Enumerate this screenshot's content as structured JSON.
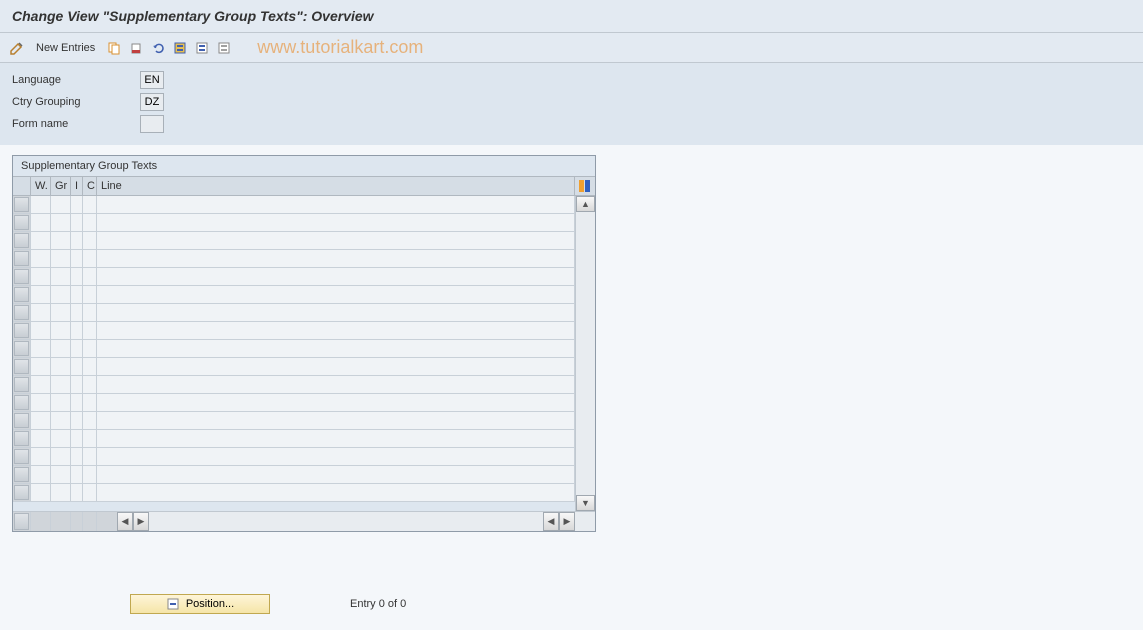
{
  "title": "Change View \"Supplementary Group Texts\": Overview",
  "toolbar": {
    "new_entries_label": "New Entries"
  },
  "watermark": "www.tutorialkart.com",
  "form": {
    "language_label": "Language",
    "language_value": "EN",
    "ctry_label": "Ctry Grouping",
    "ctry_value": "DZ",
    "form_name_label": "Form name",
    "form_name_value": ""
  },
  "table": {
    "title": "Supplementary Group Texts",
    "columns": {
      "w": "W.",
      "gr": "Gr",
      "i": "I",
      "c": "C",
      "line": "Line"
    },
    "row_count": 17
  },
  "status": {
    "position_label": "Position...",
    "entry_text": "Entry 0 of 0"
  }
}
